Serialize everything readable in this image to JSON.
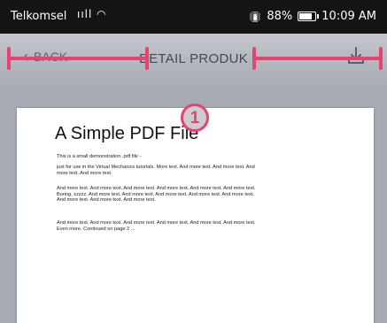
{
  "status_bar": {
    "carrier": "Telkomsel",
    "network_icons": "ııll ◠",
    "battery_percent": "88%",
    "battery_level": 0.88,
    "time": "10:09 AM"
  },
  "header": {
    "back_label": "BACK",
    "title": "DETAIL PRODUK",
    "download_icon": "download-icon"
  },
  "annotation": {
    "badge_number": "1",
    "color": "#e8436f"
  },
  "document": {
    "title": "A Simple PDF File",
    "paragraphs": [
      "This is a small demonstration .pdf file -",
      "just for use in the Virtual Mechanics tutorials. More text. And more text. And more text. And more text. And more text.",
      "And more text. And more text. And more text. And more text. And more text. And more text. Boring, zzzzz. And more text. And more text. And more text. And more text. And more text. And more text. And more text. And more text.",
      "And more text. And more text. And more text. And more text. And more text. And more text. Even more. Continued on page 2 ..."
    ]
  }
}
